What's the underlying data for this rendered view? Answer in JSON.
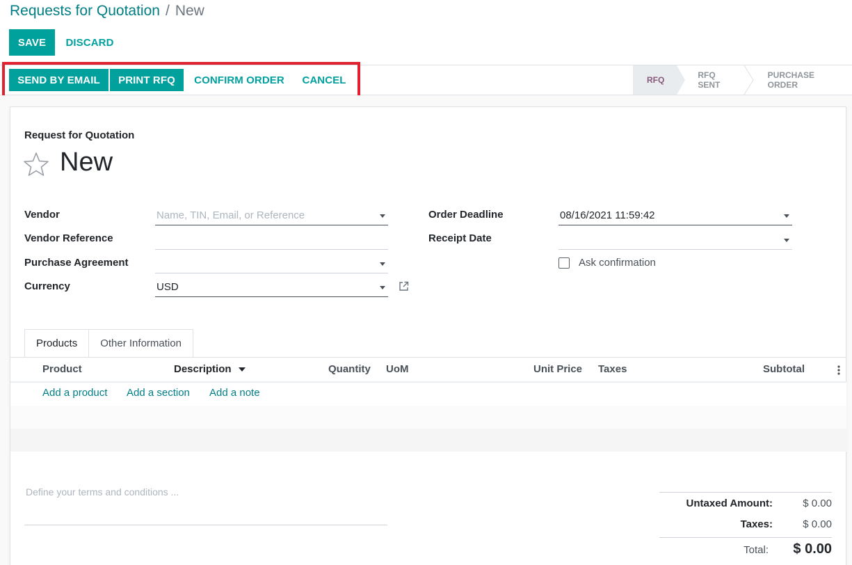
{
  "breadcrumb": {
    "parent": "Requests for Quotation",
    "separator": "/",
    "current": "New"
  },
  "control_panel": {
    "save_label": "SAVE",
    "discard_label": "DISCARD"
  },
  "header_buttons": {
    "send_email": "SEND BY EMAIL",
    "print_rfq": "PRINT RFQ",
    "confirm_order": "CONFIRM ORDER",
    "cancel": "CANCEL"
  },
  "status_stages": [
    {
      "label": "RFQ",
      "active": true
    },
    {
      "label": "RFQ SENT",
      "active": false
    },
    {
      "label": "PURCHASE ORDER",
      "active": false
    }
  ],
  "form": {
    "doc_type": "Request for Quotation",
    "name": "New",
    "vendor_label": "Vendor",
    "vendor_placeholder": "Name, TIN, Email, or Reference",
    "vendor_reference_label": "Vendor Reference",
    "purchase_agreement_label": "Purchase Agreement",
    "currency_label": "Currency",
    "currency_value": "USD",
    "order_deadline_label": "Order Deadline",
    "order_deadline_value": "08/16/2021 11:59:42",
    "receipt_date_label": "Receipt Date",
    "ask_confirmation_label": "Ask confirmation"
  },
  "tabs": [
    {
      "label": "Products",
      "active": true
    },
    {
      "label": "Other Information",
      "active": false
    }
  ],
  "lines_table": {
    "columns": [
      "Product",
      "Description",
      "Quantity",
      "UoM",
      "Unit Price",
      "Taxes",
      "Subtotal"
    ],
    "add_product": "Add a product",
    "add_section": "Add a section",
    "add_note": "Add a note"
  },
  "terms_placeholder": "Define your terms and conditions ...",
  "totals": {
    "untaxed_label": "Untaxed Amount:",
    "untaxed_value": "$ 0.00",
    "taxes_label": "Taxes:",
    "taxes_value": "$ 0.00",
    "total_label": "Total:",
    "total_value": "$ 0.00"
  },
  "colors": {
    "primary": "#00A09D",
    "link": "#017e84",
    "active_stage": "#875a7b",
    "highlight_box": "#e02230"
  }
}
